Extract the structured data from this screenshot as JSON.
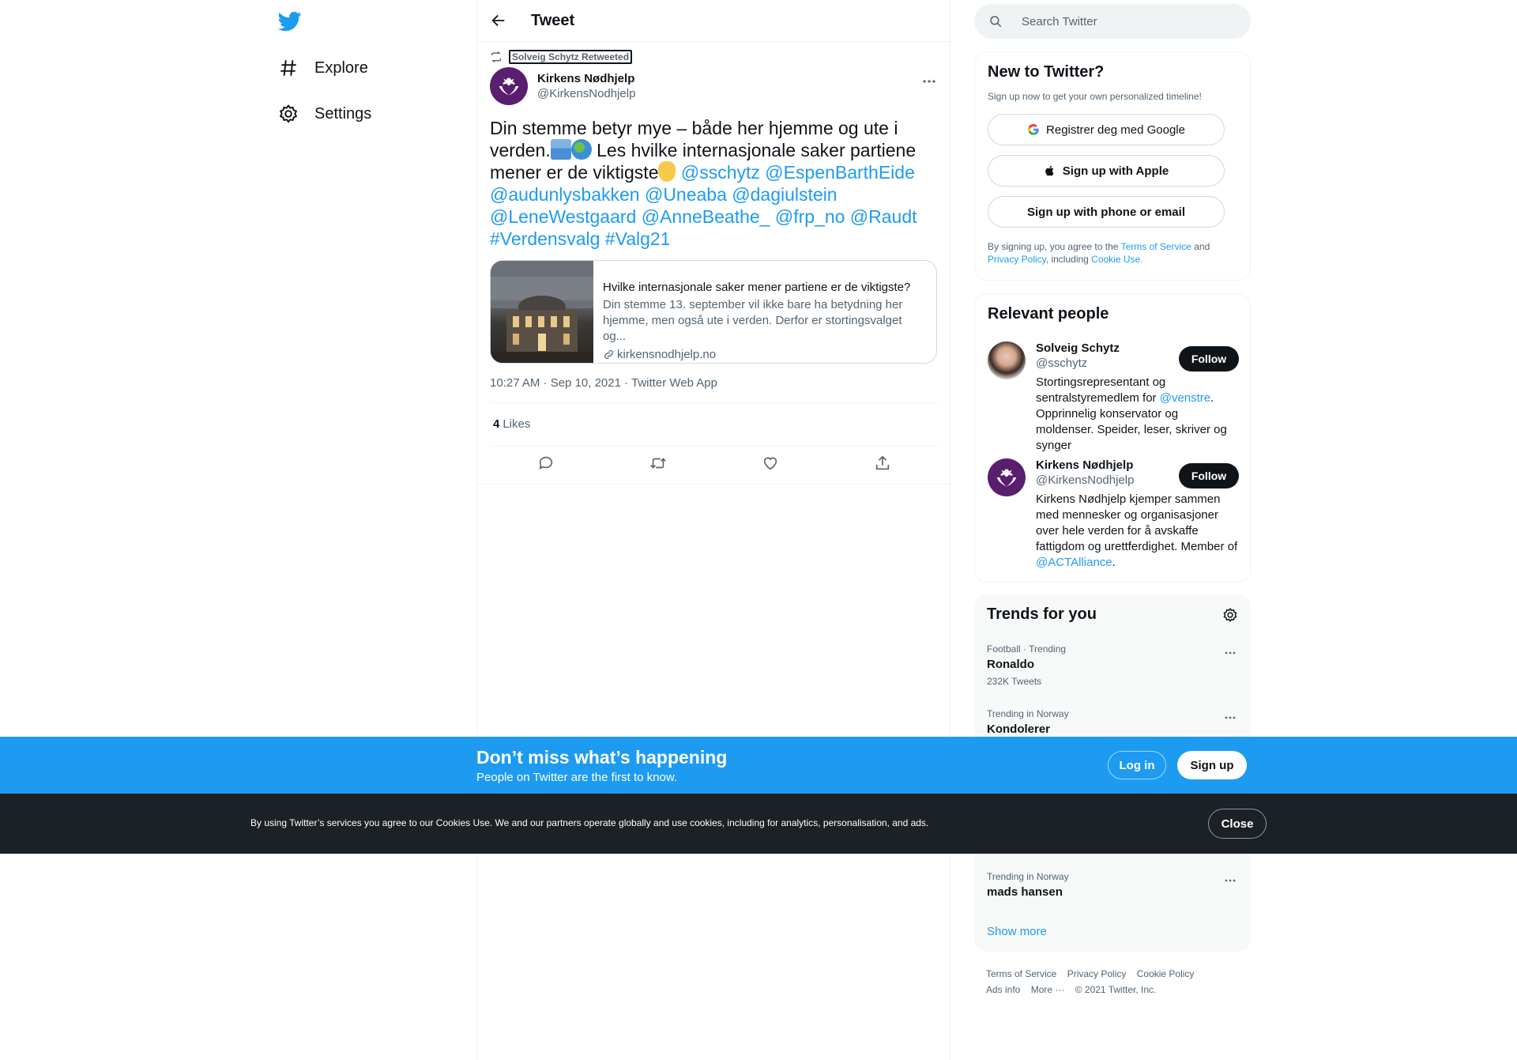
{
  "nav": {
    "explore_label": "Explore",
    "settings_label": "Settings"
  },
  "header": {
    "title": "Tweet"
  },
  "tweet": {
    "retweeted_by": "Solveig Schytz Retweeted",
    "author_name": "Kirkens Nødhjelp",
    "author_handle": "@KirkensNodhjelp",
    "text_part1": "Din stemme betyr mye – både her hjemme og ute i verden.",
    "text_part2": " Les hvilke internasjonale saker partiene mener er de viktigste",
    "text_links": "@sschytz @EspenBarthEide @audunlysbakken @Uneaba @dagiulstein @LeneWestgaard @AnneBeathe_ @frp_no @Raudt #Verdensvalg #Valg21",
    "card": {
      "title": "Hvilke internasjonale saker mener partiene er de viktigste?",
      "description": "Din stemme 13. september vil ikke bare ha betydning her hjemme, men også ute i verden. Derfor er stortingsvalget og...",
      "domain": "kirkensnodhjelp.no"
    },
    "timestamp": "10:27 AM · Sep 10, 2021 · Twitter Web App",
    "likes_count": "4",
    "likes_label": "Likes"
  },
  "search": {
    "placeholder": "Search Twitter"
  },
  "new_to_twitter": {
    "title": "New to Twitter?",
    "subtitle": "Sign up now to get your own personalized timeline!",
    "google_label": "Registrer deg med Google",
    "apple_label": "Sign up with Apple",
    "phone_label": "Sign up with phone or email",
    "legal_prefix": "By signing up, you agree to the ",
    "terms_link": "Terms of Service",
    "legal_and": " and",
    "privacy_link": "Privacy Policy",
    "legal_including": ", including ",
    "cookie_link": "Cookie Use."
  },
  "relevant_people": {
    "title": "Relevant people",
    "follow_label": "Follow",
    "people": [
      {
        "name": "Solveig Schytz",
        "handle": "@sschytz",
        "bio_before": "Stortingsrepresentant og sentralstyremedlem for ",
        "bio_link": "@venstre",
        "bio_after": ". Opprinnelig konservator og moldenser. Speider, leser, skriver og synger"
      },
      {
        "name": "Kirkens Nødhjelp",
        "handle": "@KirkensNodhjelp",
        "bio_before": "Kirkens Nødhjelp kjemper sammen med mennesker og organisasjoner over hele verden for å avskaffe fattigdom og urettferdighet. Member of ",
        "bio_link": "@ACTAlliance",
        "bio_after": "."
      }
    ]
  },
  "trends": {
    "title": "Trends for you",
    "items": [
      {
        "meta": "Football · Trending",
        "name": "Ronaldo",
        "count": "232K Tweets"
      },
      {
        "meta": "Trending in Norway",
        "name": "Kondolerer",
        "count": ""
      },
      {
        "meta": "Trending in Norway",
        "name": "mads hansen",
        "count": ""
      }
    ],
    "show_more": "Show more"
  },
  "footer": {
    "terms": "Terms of Service",
    "privacy": "Privacy Policy",
    "cookie": "Cookie Policy",
    "ads": "Ads info",
    "more": "More ···",
    "copyright": "© 2021 Twitter, Inc."
  },
  "banner": {
    "title": "Don’t miss what’s happening",
    "subtitle": "People on Twitter are the first to know.",
    "login_label": "Log in",
    "signup_label": "Sign up"
  },
  "cookie_bar": {
    "text": "By using Twitter’s services you agree to our Cookies Use. We and our partners operate globally and use cookies, including for analytics, personalisation, and ads.",
    "close_label": "Close"
  },
  "colors": {
    "brand_blue": "#1d9bf0",
    "text_primary": "#0f1419",
    "text_secondary": "#536471",
    "cookie_bg": "#1b2125"
  }
}
